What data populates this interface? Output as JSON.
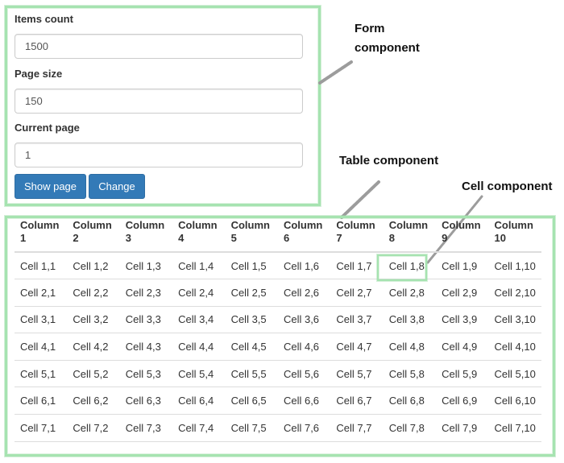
{
  "form": {
    "items_count_label": "Items count",
    "items_count_value": "1500",
    "page_size_label": "Page size",
    "page_size_value": "150",
    "current_page_label": "Current page",
    "current_page_value": "1",
    "show_page_label": "Show page",
    "change_label": "Change"
  },
  "annotations": {
    "form_line1": "Form",
    "form_line2": "component",
    "table": "Table component",
    "cell": "Cell component"
  },
  "table": {
    "headers": [
      [
        "Column",
        "1"
      ],
      [
        "Column",
        "2"
      ],
      [
        "Column",
        "3"
      ],
      [
        "Column",
        "4"
      ],
      [
        "Column",
        "5"
      ],
      [
        "Column",
        "6"
      ],
      [
        "Column",
        "7"
      ],
      [
        "Column",
        "8"
      ],
      [
        "Column",
        "9"
      ],
      [
        "Column",
        "10"
      ]
    ],
    "rows": [
      [
        "Cell 1,1",
        "Cell 1,2",
        "Cell 1,3",
        "Cell 1,4",
        "Cell 1,5",
        "Cell 1,6",
        "Cell 1,7",
        "Cell 1,8",
        "Cell 1,9",
        "Cell 1,10"
      ],
      [
        "Cell 2,1",
        "Cell 2,2",
        "Cell 2,3",
        "Cell 2,4",
        "Cell 2,5",
        "Cell 2,6",
        "Cell 2,7",
        "Cell 2,8",
        "Cell 2,9",
        "Cell 2,10"
      ],
      [
        "Cell 3,1",
        "Cell 3,2",
        "Cell 3,3",
        "Cell 3,4",
        "Cell 3,5",
        "Cell 3,6",
        "Cell 3,7",
        "Cell 3,8",
        "Cell 3,9",
        "Cell 3,10"
      ],
      [
        "Cell 4,1",
        "Cell 4,2",
        "Cell 4,3",
        "Cell 4,4",
        "Cell 4,5",
        "Cell 4,6",
        "Cell 4,7",
        "Cell 4,8",
        "Cell 4,9",
        "Cell 4,10"
      ],
      [
        "Cell 5,1",
        "Cell 5,2",
        "Cell 5,3",
        "Cell 5,4",
        "Cell 5,5",
        "Cell 5,6",
        "Cell 5,7",
        "Cell 5,8",
        "Cell 5,9",
        "Cell 5,10"
      ],
      [
        "Cell 6,1",
        "Cell 6,2",
        "Cell 6,3",
        "Cell 6,4",
        "Cell 6,5",
        "Cell 6,6",
        "Cell 6,7",
        "Cell 6,8",
        "Cell 6,9",
        "Cell 6,10"
      ],
      [
        "Cell 7,1",
        "Cell 7,2",
        "Cell 7,3",
        "Cell 7,4",
        "Cell 7,5",
        "Cell 7,6",
        "Cell 7,7",
        "Cell 7,8",
        "Cell 7,9",
        "Cell 7,10"
      ]
    ]
  },
  "colors": {
    "highlight_border": "#a6e3b0",
    "button_primary": "#337ab7",
    "arrow": "#999999"
  }
}
